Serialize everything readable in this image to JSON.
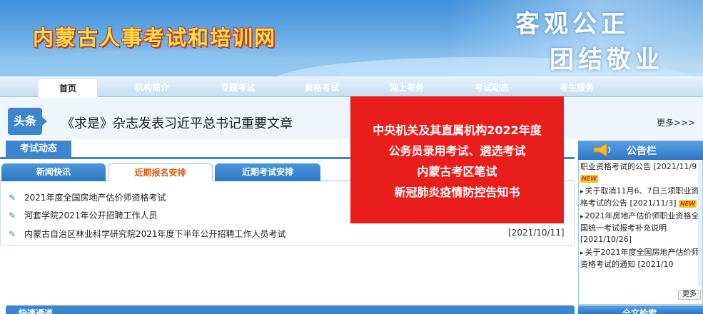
{
  "header": {
    "site_title": "内蒙古人事考试和培训网",
    "motto_line1": "客观公正",
    "motto_line2": "团结敬业"
  },
  "nav": {
    "items": [
      {
        "label": "首页"
      },
      {
        "label": "机构简介"
      },
      {
        "label": "专题考试"
      },
      {
        "label": "资格考试"
      },
      {
        "label": "网上考务"
      },
      {
        "label": "考试动态"
      },
      {
        "label": "考生服务"
      }
    ],
    "active_index": 0
  },
  "headline": {
    "tag": "头条",
    "text": "《求是》杂志发表习近平总书记重要文章",
    "more": "更多>>>"
  },
  "exam_news": {
    "title": "考试动态",
    "tabs": [
      {
        "label": "新闻快讯"
      },
      {
        "label": "近期报名安排"
      },
      {
        "label": "近期考试安排"
      }
    ],
    "active_tab": 1,
    "items": [
      {
        "text": "2021年度全国房地产估价师资格考试"
      },
      {
        "text": "河套学院2021年公开招聘工作人员"
      },
      {
        "text": "内蒙古自治区林业科学研究院2021年度下半年公开招聘工作人员考试"
      }
    ],
    "last_date": "[2021/10/11]"
  },
  "notice": {
    "lines": [
      "中央机关及其直属机构2022年度",
      "公务员录用考试、遴选考试",
      "内蒙古考区笔试",
      "新冠肺炎疫情防控告知书"
    ]
  },
  "bulletin": {
    "title": "公告栏",
    "items": [
      {
        "text": "职业资格考试的公告 [2021/11/9]",
        "new": true
      },
      {
        "text": "关于取消11月6、7日三项职业资格考试的公告 [2021/11/3]",
        "new": true
      },
      {
        "text": "2021年房地产估价师职业资格全国统一考试报考补充说明 [2021/10/26]",
        "new": false
      },
      {
        "text": "关于2021年度全国房地产估价师资格考试的通知 [2021/10",
        "new": false
      }
    ],
    "new_label": "NEW",
    "more": "更多"
  },
  "bottom": {
    "left_label": "快速通道",
    "right_label": "全文检索"
  },
  "colors": {
    "primary_blue": "#3d86cf",
    "notice_red": "#ea1d1d",
    "title_yellow": "#f7e04a"
  }
}
